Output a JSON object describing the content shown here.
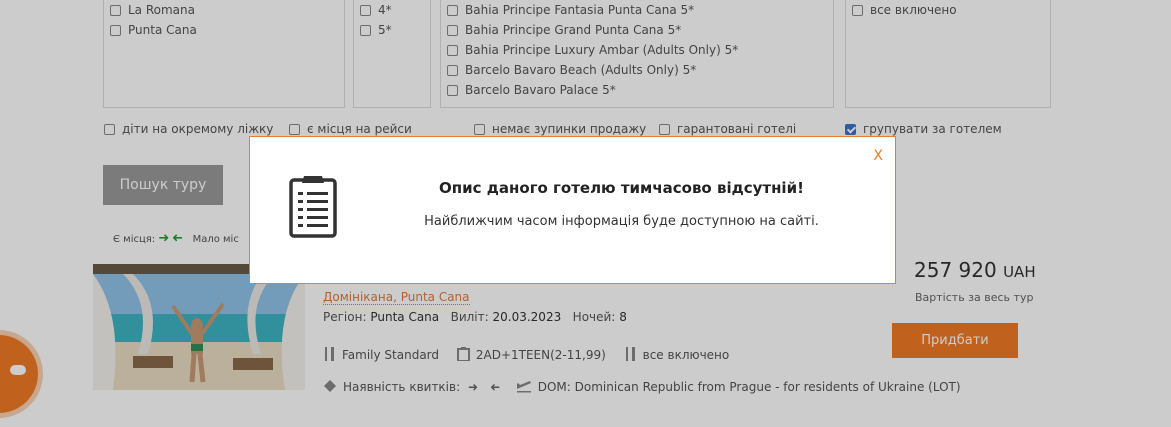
{
  "filters": {
    "regions": [
      "La Romana",
      "Punta Cana"
    ],
    "stars": [
      "4*",
      "5*"
    ],
    "hotels": [
      "Bahia Principe Fantasia Punta Cana 5*",
      "Bahia Principe Grand Punta Cana 5*",
      "Bahia Principe Luxury Ambar (Adults Only) 5*",
      "Barcelo Bavaro Beach (Adults Only) 5*",
      "Barcelo Bavaro Palace 5*"
    ],
    "meals": [
      "все включено"
    ]
  },
  "flags": [
    {
      "label": "діти на окремому ліжку",
      "checked": false
    },
    {
      "label": "є місця на рейси",
      "checked": false
    },
    {
      "label": "немає зупинки продажу",
      "checked": false
    },
    {
      "label": "гарантовані готелі",
      "checked": false
    },
    {
      "label": "групувати за готелем",
      "checked": true
    }
  ],
  "search_button": "Пошук туру",
  "legend": {
    "available": "Є місця:",
    "few": "Мало міс"
  },
  "tour": {
    "country_region": "Домінікана, Punta Cana",
    "region_label": "Регіон:",
    "region_value": "Punta Cana",
    "departure_label": "Виліт:",
    "departure_value": "20.03.2023",
    "nights_label": "Ночей:",
    "nights_value": "8",
    "room": "Family Standard",
    "occupancy": "2AD+1TEEN(2-11,99)",
    "meal": "все включено",
    "tickets_label": "Наявність квитків:",
    "flight": "DOM: Dominican Republic from Prague - for residents of Ukraine (LOT)",
    "price_value": "257 920",
    "price_currency": "UAH",
    "price_note": "Вартість за весь тур",
    "buy_button": "Придбати"
  },
  "modal": {
    "close": "X",
    "title": "Опис даного готелю тимчасово відсутній!",
    "text": "Найближчим часом інформація буде доступною на сайті."
  },
  "colors": {
    "accent": "#f07b26",
    "checkbox_checked": "#3b73c9",
    "arrow_green": "#2a9d3a"
  }
}
